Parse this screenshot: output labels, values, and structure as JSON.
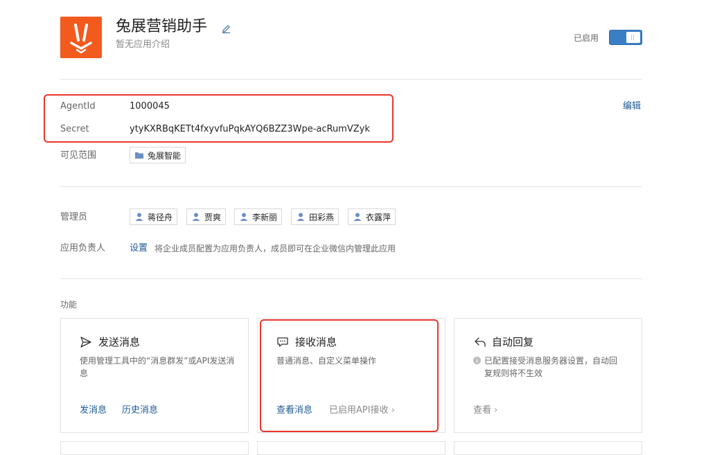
{
  "app": {
    "name": "兔展营销助手",
    "description": "暂无应用介绍",
    "status_label": "已启用",
    "enabled": true
  },
  "info": {
    "agentid_label": "AgentId",
    "agentid_value": "1000045",
    "secret_label": "Secret",
    "secret_value": "ytyKXRBqKETt4fxyvfuPqkAYQ6BZZ3Wpe-acRumVZyk",
    "edit_link": "编辑",
    "visible_range_label": "可见范围",
    "visible_range_tag": "兔展智能"
  },
  "admins": {
    "label": "管理员",
    "names": [
      "蒋径舟",
      "贾爽",
      "李新丽",
      "田彩燕",
      "衣露萍"
    ]
  },
  "owner": {
    "label": "应用负责人",
    "link": "设置",
    "hint": "将企业成员配置为应用负责人，成员即可在企业微信内管理此应用"
  },
  "features": {
    "section_label": "功能",
    "send": {
      "title": "发送消息",
      "desc": "使用管理工具中的“消息群发”或API发送消息",
      "link1": "发消息",
      "link2": "历史消息"
    },
    "receive": {
      "title": "接收消息",
      "desc": "普通消息、自定义菜单操作",
      "link": "查看消息",
      "status": "已启用API接收"
    },
    "auto_reply": {
      "title": "自动回复",
      "desc": "已配置接受消息服务器设置，自动回复规则将不生效",
      "link": "查看"
    }
  },
  "colors": {
    "accent_link": "#1e5a97",
    "toggle_on": "#3b7ec6",
    "logo_bg": "#f25a1e",
    "highlight_border": "#e8352c"
  }
}
